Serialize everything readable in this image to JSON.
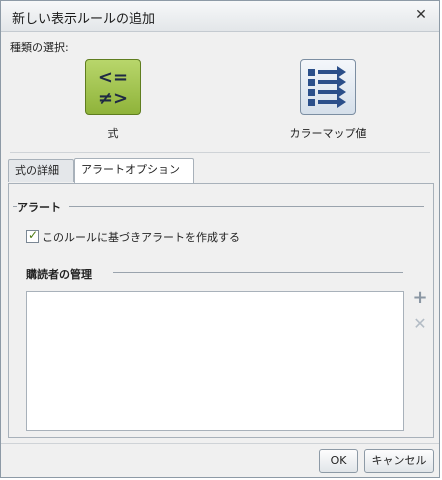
{
  "dialog": {
    "title": "新しい表示ルールの追加",
    "close_label": "✕"
  },
  "type_selection": {
    "label": "種類の選択:",
    "options": [
      {
        "label": "式",
        "icon": "formula-icon",
        "glyph_top": "<=",
        "glyph_bottom": "≠>"
      },
      {
        "label": "カラーマップ値",
        "icon": "colormap-list-icon"
      }
    ]
  },
  "tabs": [
    {
      "label": "式の詳細",
      "active": false
    },
    {
      "label": "アラートオプション",
      "active": true
    }
  ],
  "alert": {
    "group_title": "アラート",
    "checkbox_label": "このルールに基づきアラートを作成する",
    "checked": true
  },
  "subscribers": {
    "group_title": "購読者の管理",
    "add_icon": "plus-icon",
    "remove_icon": "x-icon"
  },
  "footer": {
    "ok_label": "OK",
    "cancel_label": "キャンセル"
  },
  "colors": {
    "formula_green": "#9fc34a",
    "colormap_blue": "#2b4f8a"
  }
}
